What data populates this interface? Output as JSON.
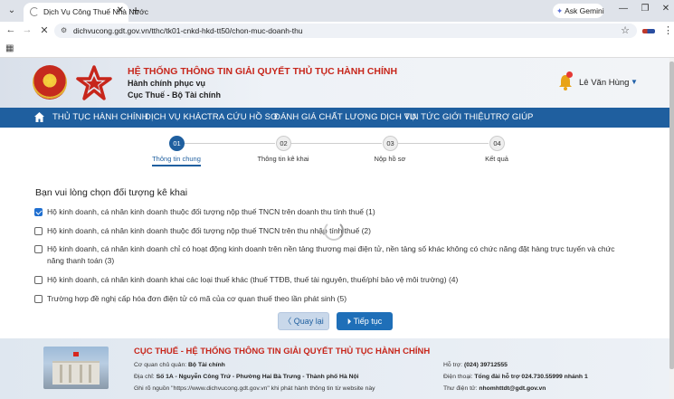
{
  "browser": {
    "tab_title": "Dịch Vụ Công Thuế Nhà Nước",
    "new_tab": "+",
    "ask_gemini": "Ask Gemini",
    "url": "dichvucong.gdt.gov.vn/tthc/tk01-cnkd-hkd-tt50/chon-muc-doanh-thu"
  },
  "header": {
    "title": "HỆ THỐNG THÔNG TIN GIẢI QUYẾT THỦ TỤC HÀNH CHÍNH",
    "subtitle_1": "Hành chính phục vụ",
    "subtitle_2": "Cục Thuế - Bộ Tài chính",
    "user_name": "Lê Văn Hùng"
  },
  "nav": {
    "items": [
      "THỦ TỤC HÀNH CHÍNH",
      "DỊCH VỤ KHÁC",
      "TRA CỨU HỒ SƠ",
      "ĐÁNH GIÁ CHẤT LƯỢNG DỊCH VỤ",
      "TIN TỨC",
      "GIỚI THIỆU",
      "TRỢ GIÚP"
    ]
  },
  "stepper": {
    "steps": [
      {
        "num": "01",
        "label": "Thông tin chung",
        "active": true
      },
      {
        "num": "02",
        "label": "Thông tin kê khai",
        "active": false
      },
      {
        "num": "03",
        "label": "Nộp hồ sơ",
        "active": false
      },
      {
        "num": "04",
        "label": "Kết quả",
        "active": false
      }
    ]
  },
  "form": {
    "question": "Bạn vui lòng chọn đối tượng kê khai",
    "options": [
      {
        "text": "Hộ kinh doanh, cá nhân kinh doanh thuộc đối tượng nộp thuế TNCN trên doanh thu tính thuế (1)",
        "checked": true
      },
      {
        "text": "Hộ kinh doanh, cá nhân kinh doanh thuộc đối tượng nộp thuế TNCN trên thu nhập tính thuế (2)",
        "checked": false
      },
      {
        "text_line1": "Hộ kinh doanh, cá nhân kinh doanh chỉ có hoạt động kinh doanh trên nền tảng thương mại điện tử, nền tảng số khác không có chức năng đặt hàng trực tuyến và chức",
        "text_line2": "năng thanh toán (3)",
        "checked": false
      },
      {
        "text": "Hộ kinh doanh, cá nhân kinh doanh khai các loại thuế khác (thuế TTĐB, thuế tài nguyên, thuế/phí bảo vệ môi trường) (4)",
        "checked": false
      },
      {
        "text": "Trường hợp đề nghị cấp hóa đơn điện tử có mã của cơ quan thuế theo lần phát sinh (5)",
        "checked": false
      }
    ],
    "back_label": "〈  Quay lại",
    "next_label": "⏵  Tiếp tục"
  },
  "footer": {
    "title": "CỤC THUẾ - HỆ THỐNG THÔNG TIN GIẢI QUYẾT THỦ TỤC HÀNH CHÍNH",
    "agency_label": "Cơ quan chủ quản:",
    "agency_value": "Bộ Tài chính",
    "address_label": "Địa chỉ:",
    "address_value": "Số 1A - Nguyễn Công Trứ - Phường Hai Bà Trưng - Thành phố Hà Nội",
    "source_note": "Ghi rõ nguồn \"https://www.dichvucong.gdt.gov.vn\" khi phát hành thông tin từ website này",
    "support_label": "Hỗ trợ:",
    "support_value": "(024) 39712555",
    "phone_label": "Điện thoại:",
    "phone_value": "Tổng đài hỗ trợ 024.730.55999 nhánh 1",
    "email_label": "Thư điện tử:",
    "email_value": "nhomhttdt@gdt.gov.vn"
  }
}
